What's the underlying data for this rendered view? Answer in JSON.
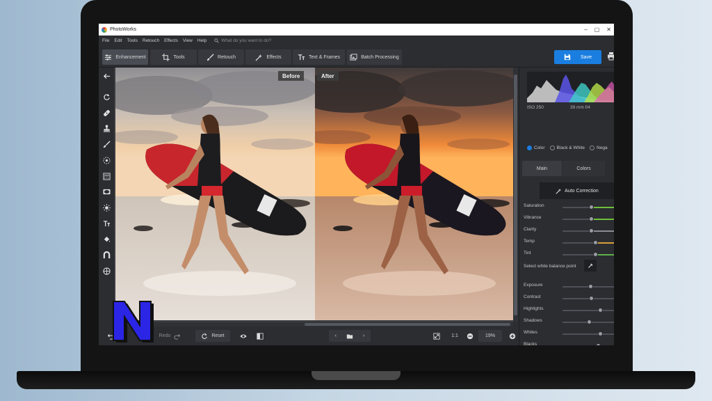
{
  "app": {
    "title": "PhotoWorks"
  },
  "menu": {
    "items": [
      "File",
      "Edit",
      "Tools",
      "Retouch",
      "Effects",
      "View",
      "Help"
    ],
    "search_placeholder": "What do you want to do?"
  },
  "toolbar": {
    "tabs": [
      {
        "label": "Enhancement",
        "icon": "sliders-icon",
        "active": true
      },
      {
        "label": "Tools",
        "icon": "crop-icon"
      },
      {
        "label": "Retouch",
        "icon": "brush-icon"
      },
      {
        "label": "Effects",
        "icon": "magic-wand-icon"
      },
      {
        "label": "Text & Frames",
        "icon": "text-icon"
      },
      {
        "label": "Batch Processing",
        "icon": "images-icon"
      }
    ],
    "save_label": "Save",
    "accent": "#1a7ee0"
  },
  "left_tools": [
    "back-arrow-icon",
    "rotate-icon",
    "healing-icon",
    "clone-stamp-icon",
    "brush-icon",
    "radial-icon",
    "gradient-icon",
    "vignette-icon",
    "light-icon",
    "text-icon",
    "paint-bucket-icon",
    "magnet-icon",
    "globe-icon"
  ],
  "canvas": {
    "before_label": "Before",
    "after_label": "After"
  },
  "bottom": {
    "redo_label": "Redo",
    "reset_label": "Reset",
    "zoom_fit": "1:1",
    "zoom_value": "19%"
  },
  "panel": {
    "histogram": {
      "iso": "ISO 250",
      "exposure": "39 mm f/4"
    },
    "modes": [
      {
        "label": "Color",
        "selected": true
      },
      {
        "label": "Black & White",
        "selected": false
      },
      {
        "label": "Nega",
        "selected": false
      }
    ],
    "tabs": [
      "Main",
      "Colors"
    ],
    "auto_correction": "Auto Correction",
    "white_balance_label": "Select white balance point",
    "sliders_top": [
      {
        "label": "Saturation",
        "value": 0.55,
        "color": "#6fbf3a"
      },
      {
        "label": "Vibrance",
        "value": 0.55,
        "color": "#6fbf3a"
      },
      {
        "label": "Clarity",
        "value": 0.55,
        "color": "#8a8d93"
      },
      {
        "label": "Temp",
        "value": 0.62,
        "color": "#d9a23a"
      },
      {
        "label": "Tint",
        "value": 0.62,
        "color": "#5fb04a"
      }
    ],
    "sliders_bottom": [
      {
        "label": "Exposure",
        "value": 0.53
      },
      {
        "label": "Contrast",
        "value": 0.55
      },
      {
        "label": "Highlights",
        "value": 0.72
      },
      {
        "label": "Shadows",
        "value": 0.5
      },
      {
        "label": "Whites",
        "value": 0.72
      },
      {
        "label": "Blacks",
        "value": 0.68
      }
    ]
  }
}
